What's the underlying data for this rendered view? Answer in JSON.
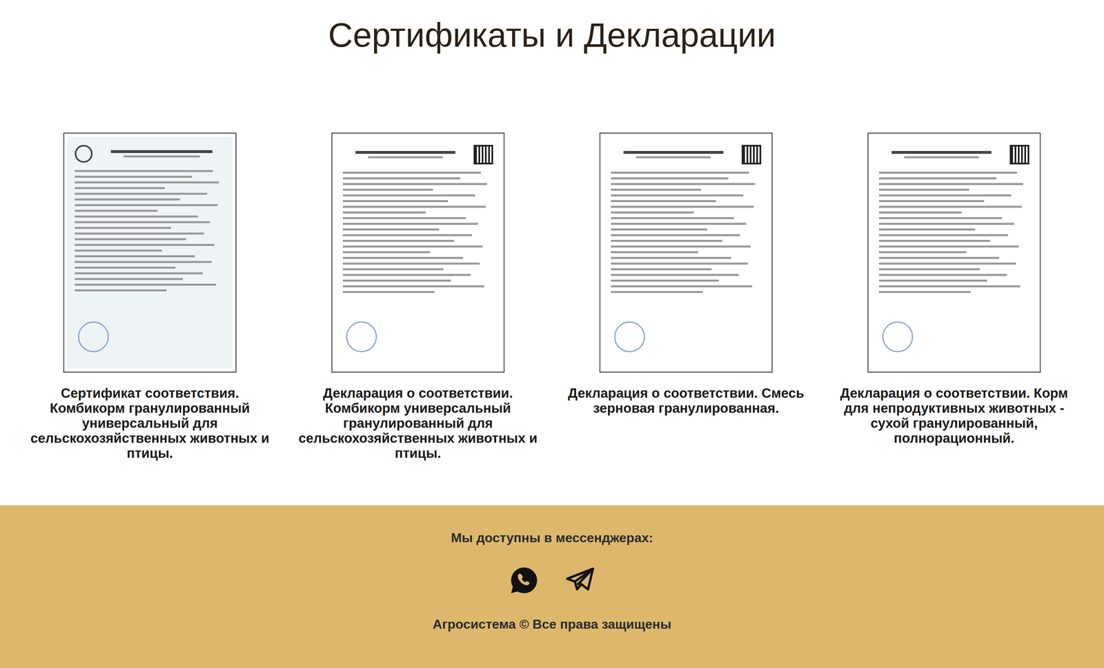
{
  "page": {
    "title": "Сертификаты и Декларации"
  },
  "documents": [
    {
      "kind": "certificate",
      "caption": "Сертификат соответствия. Комбикорм гранулированный универсальный для сельскохозяйственных животных и птицы."
    },
    {
      "kind": "declaration",
      "caption": "Декларация о соответствии. Комбикорм универсальный гранулированный для сельскохозяйственных животных и птицы."
    },
    {
      "kind": "declaration",
      "caption": "Декларация о соответствии. Смесь зерновая гранулированная."
    },
    {
      "kind": "declaration",
      "caption": "Декларация о соответствии. Корм для непродуктивных животных - сухой гранулированный, полнорационный."
    }
  ],
  "footer": {
    "messengers_label": "Мы доступны в мессенджерах:",
    "messengers": [
      {
        "kind": "whatsapp"
      },
      {
        "kind": "telegram"
      }
    ],
    "copyright": "Агросистема © Все права защищены"
  }
}
